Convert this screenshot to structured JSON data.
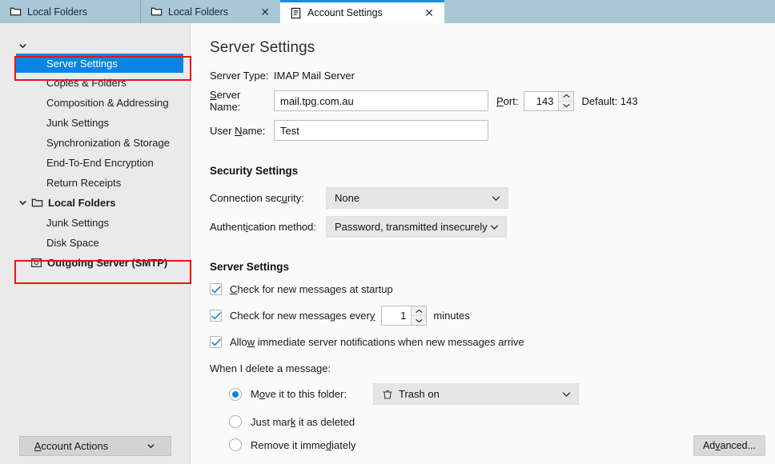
{
  "tabs": [
    {
      "label": "Local Folders",
      "icon": "folder-icon",
      "closable": false,
      "active": false
    },
    {
      "label": "Local Folders",
      "icon": "folder-icon",
      "closable": true,
      "active": false
    },
    {
      "label": "Account Settings",
      "icon": "document-icon",
      "closable": true,
      "active": true
    }
  ],
  "close_glyph": "✕",
  "sidebar": {
    "items": [
      {
        "label": "Server Settings",
        "type": "leaf",
        "selected": true,
        "highlighted": true
      },
      {
        "label": "Copies & Folders",
        "type": "leaf",
        "selected": false
      },
      {
        "label": "Composition & Addressing",
        "type": "leaf",
        "selected": false
      },
      {
        "label": "Junk Settings",
        "type": "leaf",
        "selected": false
      },
      {
        "label": "Synchronization & Storage",
        "type": "leaf",
        "selected": false
      },
      {
        "label": "End-To-End Encryption",
        "type": "leaf",
        "selected": false
      },
      {
        "label": "Return Receipts",
        "type": "leaf",
        "selected": false
      },
      {
        "label": "Local Folders",
        "type": "group",
        "icon": "folder-icon"
      },
      {
        "label": "Junk Settings",
        "type": "leaf",
        "selected": false
      },
      {
        "label": "Disk Space",
        "type": "leaf",
        "selected": false
      },
      {
        "label": "Outgoing Server (SMTP)",
        "type": "smtp",
        "icon": "smtp-icon",
        "highlighted": true
      }
    ],
    "account_actions_label": "Account Actions"
  },
  "content": {
    "title": "Server Settings",
    "server_type_label": "Server Type:",
    "server_type_value": "IMAP Mail Server",
    "server_name_label": "Server Name:",
    "server_name_value": "mail.tpg.com.au",
    "port_label": "Port:",
    "port_value": "143",
    "port_default": "Default: 143",
    "user_name_label": "User Name:",
    "user_name_value": "Test",
    "security": {
      "title": "Security Settings",
      "connection_label": "Connection security:",
      "connection_value": "None",
      "auth_label": "Authentication method:",
      "auth_value": "Password, transmitted insecurely"
    },
    "server": {
      "title": "Server Settings",
      "check_startup_label": "Check for new messages at startup",
      "check_startup_checked": true,
      "check_every_label": "Check for new messages every",
      "check_every_value": "1",
      "check_every_suffix": "minutes",
      "check_every_checked": true,
      "allow_notify_label": "Allow immediate server notifications when new messages arrive",
      "allow_notify_checked": true
    },
    "delete": {
      "prompt": "When I delete a message:",
      "options": [
        {
          "label": "Move it to this folder:",
          "selected": true
        },
        {
          "label": "Just mark it as deleted",
          "selected": false
        },
        {
          "label": "Remove it immediately",
          "selected": false
        }
      ],
      "folder_value": "Trash on",
      "folder_icon": "trash-icon"
    },
    "advanced_label": "Advanced..."
  },
  "colors": {
    "tabbar": "#a9c7d7",
    "selection_blue": "#0b84e8",
    "annotation_red": "#ee1111",
    "sidebar_bg": "#eaeaea",
    "content_bg": "#fafafa"
  }
}
